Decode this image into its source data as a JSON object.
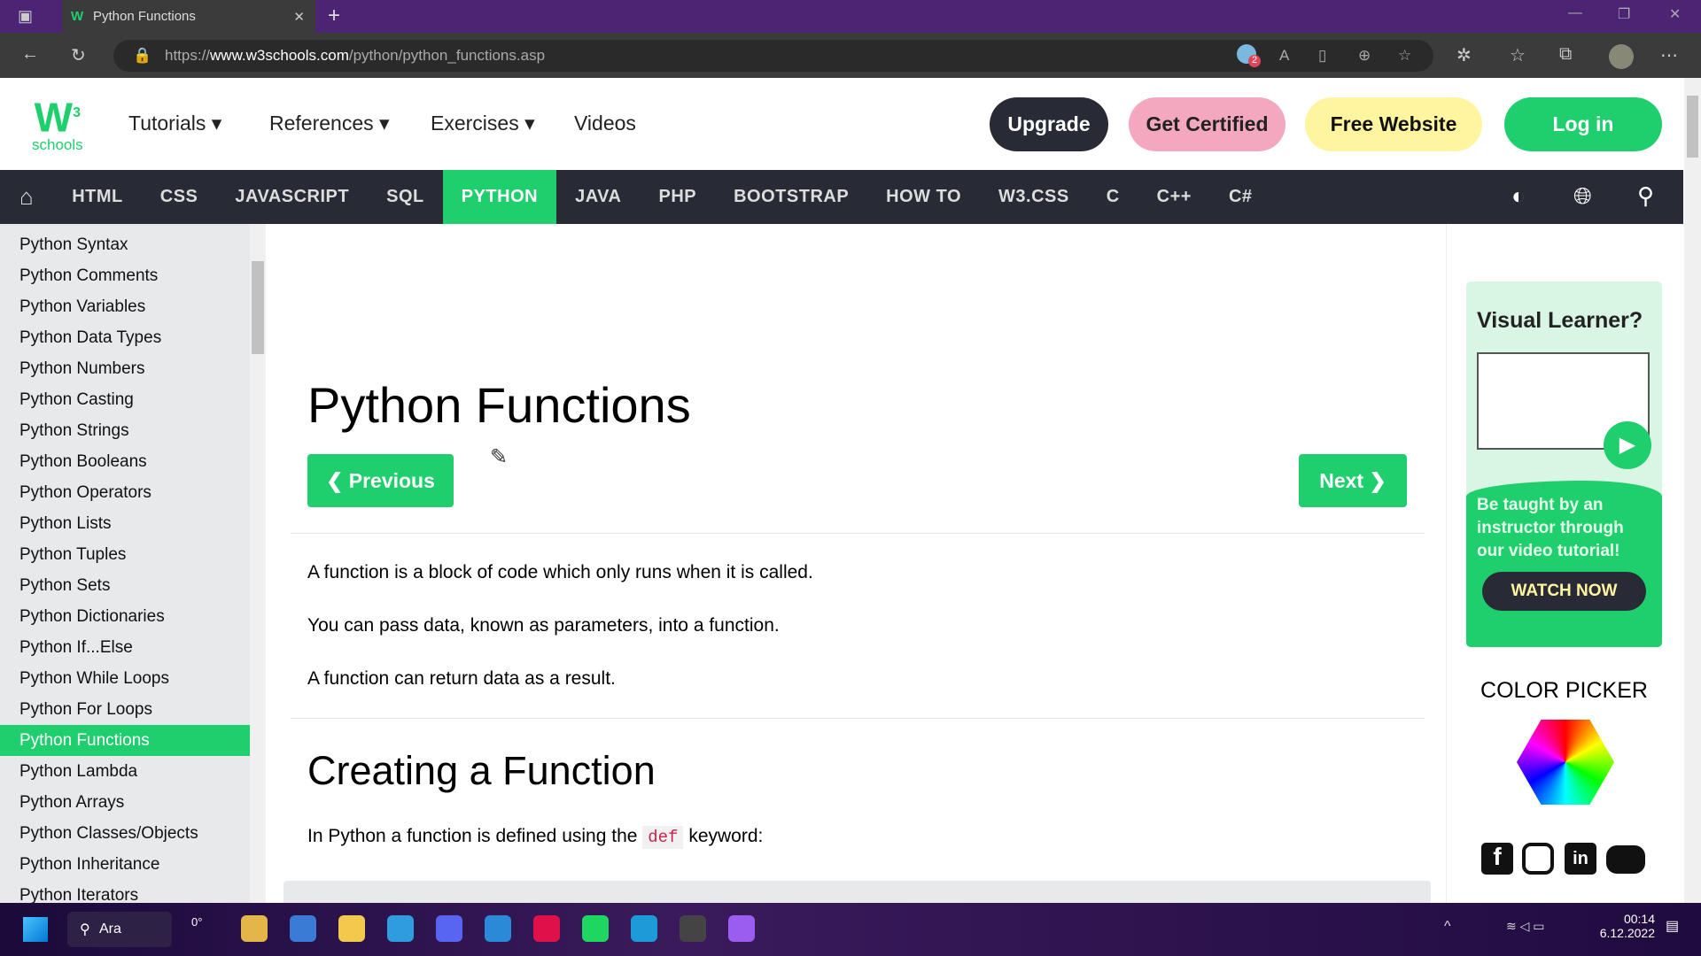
{
  "browser": {
    "tab_title": "Python Functions",
    "url_prefix": "https://",
    "url_domain": "www.w3schools.com",
    "url_path": "/python/python_functions.asp",
    "tracker_badge": "2"
  },
  "header": {
    "logo_text": "w3 schools",
    "menus": [
      "Tutorials",
      "References",
      "Exercises",
      "Videos"
    ],
    "buttons": {
      "upgrade": "Upgrade",
      "certified": "Get Certified",
      "website": "Free Website",
      "login": "Log in"
    }
  },
  "nav": {
    "items": [
      "HTML",
      "CSS",
      "JAVASCRIPT",
      "SQL",
      "PYTHON",
      "JAVA",
      "PHP",
      "BOOTSTRAP",
      "HOW TO",
      "W3.CSS",
      "C",
      "C++",
      "C#"
    ],
    "active": "PYTHON"
  },
  "sidebar": {
    "items": [
      "Python Syntax",
      "Python Comments",
      "Python Variables",
      "Python Data Types",
      "Python Numbers",
      "Python Casting",
      "Python Strings",
      "Python Booleans",
      "Python Operators",
      "Python Lists",
      "Python Tuples",
      "Python Sets",
      "Python Dictionaries",
      "Python If...Else",
      "Python While Loops",
      "Python For Loops",
      "Python Functions",
      "Python Lambda",
      "Python Arrays",
      "Python Classes/Objects",
      "Python Inheritance",
      "Python Iterators"
    ],
    "active": "Python Functions"
  },
  "main": {
    "title": "Python Functions",
    "prev": "❮ Previous",
    "next": "Next ❯",
    "paragraphs": [
      "A function is a block of code which only runs when it is called.",
      "You can pass data, known as parameters, into a function.",
      "A function can return data as a result."
    ],
    "h2": "Creating a Function",
    "def_pre": "In Python a function is defined using the ",
    "def_code": "def",
    "def_post": " keyword:"
  },
  "ad": {
    "title": "Visual Learner?",
    "body": "Be taught by an instructor through our video tutorial!",
    "cta": "WATCH NOW"
  },
  "right": {
    "color_picker": "COLOR PICKER"
  },
  "taskbar": {
    "search": "Ara",
    "weather": "0°",
    "time": "00:14",
    "date": "6.12.2022"
  },
  "colors": {
    "accent": "#1fcf6d",
    "nav": "#282a35",
    "tabbar": "#4b2574"
  }
}
